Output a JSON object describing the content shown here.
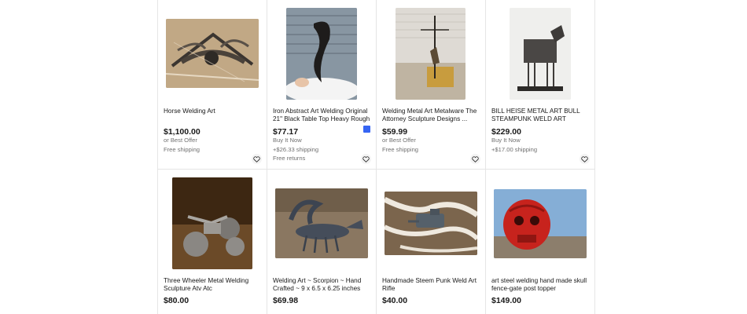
{
  "colors": {
    "accent": "#3665f3",
    "border": "#e5e5e5",
    "muted": "#707070"
  },
  "listings": [
    {
      "title": "Horse Welding Art",
      "price": "$1,100.00",
      "lines": [
        "or Best Offer",
        "Free shipping"
      ],
      "watch_icon": "heart-icon"
    },
    {
      "title": "Iron Abstract Art Welding Original 21\" Black Table Top Heavy Rough",
      "price": "$77.17",
      "lines": [
        "Buy It Now",
        "+$26.33 shipping",
        "Free returns"
      ],
      "badge_icon": "bookmark-badge-icon",
      "watch_icon": "heart-icon"
    },
    {
      "title": "Welding Metal Art Metalware The Attorney Sculpture Designs ...",
      "price": "$59.99",
      "lines": [
        "or Best Offer",
        "Free shipping"
      ],
      "watch_icon": "heart-icon"
    },
    {
      "title": "BILL HEISE METAL ART BULL STEAMPUNK WELD ART SIGNED",
      "price": "$229.00",
      "lines": [
        "Buy It Now",
        "+$17.00 shipping"
      ],
      "watch_icon": "heart-icon"
    },
    {
      "title": "Three Wheeler Metal Welding Sculpture Atv Atc",
      "price": "$80.00",
      "lines": []
    },
    {
      "title": "Welding Art ~ Scorpion ~ Hand Crafted ~ 9 x 6.5 x 6.25 inches",
      "price": "$69.98",
      "lines": []
    },
    {
      "title": "Handmade Steem Punk Weld Art Rifle",
      "price": "$40.00",
      "lines": []
    },
    {
      "title": "art steel welding hand made skull fence-gate post topper",
      "price": "$149.00",
      "lines": []
    }
  ]
}
